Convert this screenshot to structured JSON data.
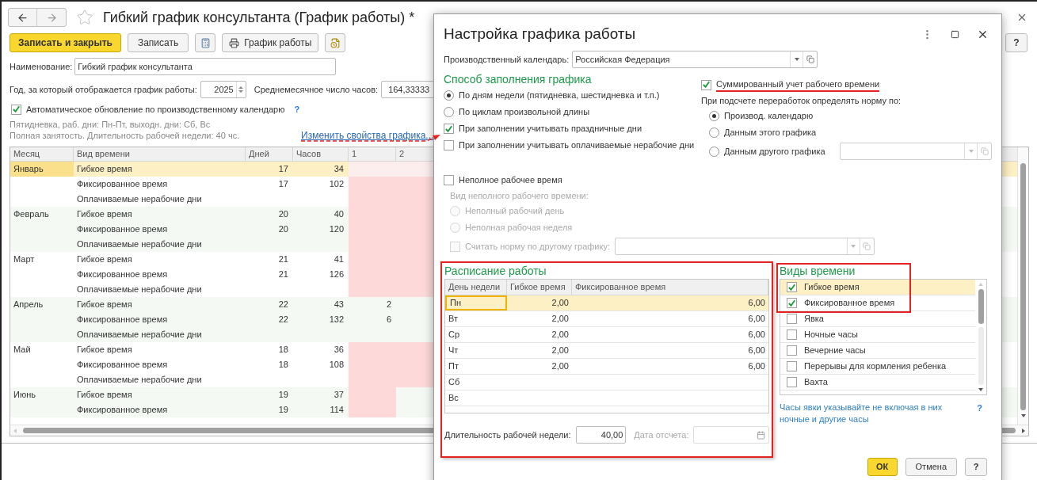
{
  "window": {
    "title": "Гибкий график консультанта (График работы) *"
  },
  "toolbar": [
    {
      "kind": "primary",
      "label": "Записать и закрыть"
    },
    {
      "kind": "plain",
      "label": "Записать"
    },
    {
      "kind": "calc"
    },
    {
      "kind": "print",
      "label": "График работы"
    },
    {
      "kind": "report"
    }
  ],
  "help_button": "?",
  "form": {
    "name": {
      "label": "Наименование:",
      "value": "Гибкий график консультанта"
    },
    "year": {
      "label": "Год, за который отображается график работы:",
      "value": "2025"
    },
    "avg_hours": {
      "label": "Среднемесячное число часов:",
      "value": "164,33333"
    },
    "auto_update": {
      "label": "Автоматическое обновление по производственному календарю",
      "checked": true,
      "help": "?"
    },
    "info_lines": [
      "Пятидневка, раб. дни: Пн-Пт, выходн. дни: Сб, Вс",
      "Полная занятость. Длительность рабочей недели: 40 чс."
    ],
    "change_link": "Изменить свойства графика..."
  },
  "table": {
    "columns": [
      "Месяц",
      "Вид времени",
      "Дней",
      "Часов",
      "1",
      "2"
    ],
    "months": [
      {
        "name": "Январь",
        "rows": [
          {
            "type": "Гибкое время",
            "days": "17",
            "hours": "34",
            "selected": true,
            "day_cells": [
              {
                "weekend": true
              },
              {
                "weekend": true
              }
            ]
          },
          {
            "type": "Фиксированное время",
            "days": "17",
            "hours": "102",
            "selected": false,
            "day_cells": [
              {
                "weekend": true
              },
              {
                "weekend": true
              }
            ]
          },
          {
            "type": "Оплачиваемые нерабочие дни",
            "selected": false,
            "day_cells": [
              {
                "weekend": true
              },
              {
                "weekend": true
              }
            ]
          }
        ]
      },
      {
        "name": "Февраль",
        "rows": [
          {
            "type": "Гибкое время",
            "days": "20",
            "hours": "40",
            "selected": false,
            "day_cells": [
              {
                "weekend": true
              },
              {
                "weekend": true
              }
            ]
          },
          {
            "type": "Фиксированное время",
            "days": "20",
            "hours": "120",
            "selected": false,
            "day_cells": [
              {
                "weekend": true
              },
              {
                "weekend": true
              }
            ]
          },
          {
            "type": "Оплачиваемые нерабочие дни",
            "selected": false,
            "day_cells": [
              {
                "weekend": true
              },
              {
                "weekend": true
              }
            ]
          }
        ]
      },
      {
        "name": "Март",
        "rows": [
          {
            "type": "Гибкое время",
            "days": "21",
            "hours": "41",
            "selected": false,
            "day_cells": [
              {
                "weekend": true
              },
              {
                "weekend": true
              }
            ]
          },
          {
            "type": "Фиксированное время",
            "days": "21",
            "hours": "126",
            "selected": false,
            "day_cells": [
              {
                "weekend": true
              },
              {
                "weekend": true
              }
            ]
          },
          {
            "type": "Оплачиваемые нерабочие дни",
            "selected": false,
            "day_cells": [
              {
                "weekend": true
              },
              {
                "weekend": true
              }
            ]
          }
        ]
      },
      {
        "name": "Апрель",
        "rows": [
          {
            "type": "Гибкое время",
            "days": "22",
            "hours": "43",
            "selected": false,
            "day_cells": [
              {
                "text": "2",
                "weekend": false
              },
              {
                "weekend": false
              }
            ]
          },
          {
            "type": "Фиксированное время",
            "days": "22",
            "hours": "132",
            "selected": false,
            "day_cells": [
              {
                "text": "6",
                "weekend": false
              },
              {
                "weekend": false
              }
            ]
          },
          {
            "type": "Оплачиваемые нерабочие дни",
            "selected": false,
            "day_cells": [
              {
                "weekend": false
              },
              {
                "weekend": false
              }
            ]
          }
        ]
      },
      {
        "name": "Май",
        "rows": [
          {
            "type": "Гибкое время",
            "days": "18",
            "hours": "36",
            "selected": false,
            "day_cells": [
              {
                "weekend": true
              },
              {
                "weekend": true
              }
            ]
          },
          {
            "type": "Фиксированное время",
            "days": "18",
            "hours": "108",
            "selected": false,
            "day_cells": [
              {
                "weekend": true
              },
              {
                "weekend": true
              }
            ]
          },
          {
            "type": "Оплачиваемые нерабочие дни",
            "selected": false,
            "day_cells": [
              {
                "weekend": true
              },
              {
                "weekend": true
              }
            ]
          }
        ]
      },
      {
        "name": "Июнь",
        "rows": [
          {
            "type": "Гибкое время",
            "days": "19",
            "hours": "37",
            "selected": false,
            "day_cells": [
              {
                "weekend": true
              },
              {
                "weekend": false
              }
            ]
          },
          {
            "type": "Фиксированное время",
            "days": "19",
            "hours": "114",
            "selected": false,
            "day_cells": [
              {
                "weekend": true
              },
              {
                "weekend": false
              }
            ]
          }
        ]
      }
    ]
  },
  "dialog": {
    "title": "Настройка графика работы",
    "calendar": {
      "label": "Производственный календарь:",
      "value": "Российская Федерация"
    },
    "fill_method": {
      "heading": "Способ заполнения графика",
      "options": [
        {
          "label": "По дням недели (пятидневка, шестидневка и т.п.)",
          "selected": true
        },
        {
          "label": "По циклам произвольной длины",
          "selected": false
        }
      ],
      "checks": [
        {
          "label": "При заполнении учитывать праздничные дни",
          "checked": true
        },
        {
          "label": "При заполнении учитывать оплачиваемые нерабочие дни",
          "checked": false
        }
      ]
    },
    "summarized": {
      "label": "Суммированный учет рабочего времени",
      "checked": true
    },
    "norm": {
      "label": "При подсчете переработок определять норму по:",
      "options": [
        {
          "label": "Производ. календарю",
          "selected": true
        },
        {
          "label": "Данным этого графика",
          "selected": false
        },
        {
          "label": "Данным другого графика",
          "selected": false
        }
      ]
    },
    "part_time": {
      "label": "Неполное рабочее время",
      "checked": false,
      "kind_label": "Вид неполного рабочего времени:",
      "options": [
        {
          "label": "Неполный рабочий день",
          "selected": false
        },
        {
          "label": "Неполная рабочая неделя",
          "selected": false
        }
      ],
      "other_norm": {
        "label": "Считать норму по другому графику:",
        "checked": false
      }
    },
    "schedule": {
      "heading": "Расписание работы",
      "columns": [
        "День недели",
        "Гибкое время",
        "Фиксированное время"
      ],
      "rows": [
        {
          "day": "Пн",
          "flex": "2,00",
          "fixed": "6,00",
          "selected": true
        },
        {
          "day": "Вт",
          "flex": "2,00",
          "fixed": "6,00",
          "selected": false
        },
        {
          "day": "Ср",
          "flex": "2,00",
          "fixed": "6,00",
          "selected": false
        },
        {
          "day": "Чт",
          "flex": "2,00",
          "fixed": "6,00",
          "selected": false
        },
        {
          "day": "Пт",
          "flex": "2,00",
          "fixed": "6,00",
          "selected": false
        },
        {
          "day": "Сб",
          "selected": false
        },
        {
          "day": "Вс",
          "selected": false
        }
      ],
      "week_length": {
        "label": "Длительность рабочей недели:",
        "value": "40,00"
      },
      "start_date": {
        "label": "Дата отсчета:"
      }
    },
    "time_types": {
      "heading": "Виды времени",
      "items": [
        {
          "label": "Гибкое время",
          "checked": true,
          "selected": true
        },
        {
          "label": "Фиксированное время",
          "checked": true,
          "selected": false
        },
        {
          "label": "Явка",
          "checked": false,
          "selected": false
        },
        {
          "label": "Ночные часы",
          "checked": false,
          "selected": false
        },
        {
          "label": "Вечерние часы",
          "checked": false,
          "selected": false
        },
        {
          "label": "Перерывы для кормления ребенка",
          "checked": false,
          "selected": false
        },
        {
          "label": "Вахта",
          "checked": false,
          "selected": false
        }
      ],
      "note": "Часы явки указывайте не включая в них ночные и другие часы",
      "help": "?"
    },
    "buttons": [
      {
        "kind": "primary",
        "label": "ОК"
      },
      {
        "kind": "plain",
        "label": "Отмена"
      },
      {
        "kind": "help",
        "label": "?"
      }
    ]
  }
}
